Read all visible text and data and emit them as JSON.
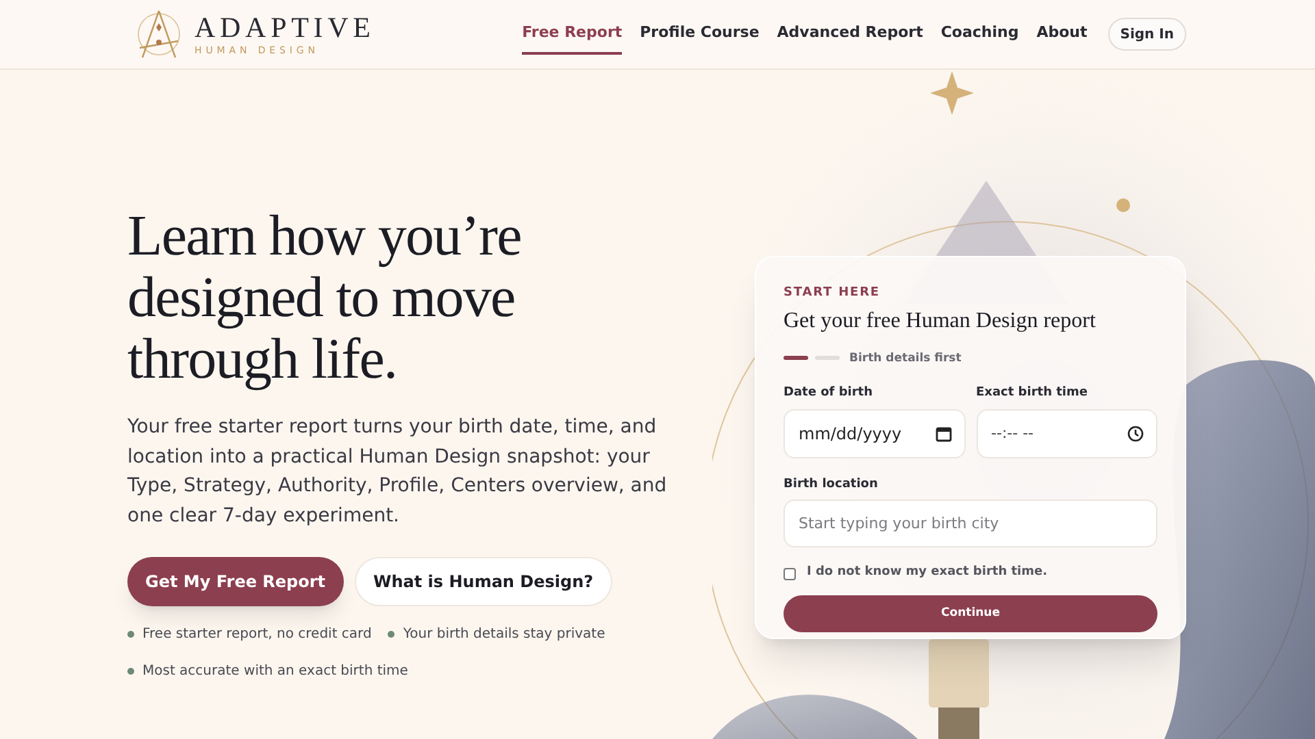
{
  "logo": {
    "name": "ADAPTIVE",
    "tagline": "HUMAN DESIGN"
  },
  "nav": {
    "items": [
      {
        "label": "Free Report",
        "selected": true
      },
      {
        "label": "Profile Course",
        "selected": false
      },
      {
        "label": "Advanced Report",
        "selected": false
      },
      {
        "label": "Coaching",
        "selected": false
      },
      {
        "label": "About",
        "selected": false
      }
    ],
    "sign_in": "Sign In"
  },
  "hero": {
    "title": "Learn how you’re designed to move through life.",
    "description": "Your free starter report turns your birth date, time, and location into a practical Human Design snapshot: your Type, Strategy, Authority, Profile, Centers overview, and one clear 7-day experiment.",
    "primary_button": "Get My Free Report",
    "secondary_button": "What is Human Design?",
    "benefits": [
      "Free starter report, no credit card",
      "Your birth details stay private",
      "Most accurate with an exact birth time"
    ]
  },
  "form": {
    "eyebrow": "START HERE",
    "title": "Get your free Human Design report",
    "progress": {
      "steps": [
        {
          "done": true
        },
        {
          "done": false
        }
      ],
      "label": "Birth details first"
    },
    "date": {
      "label": "Date of birth",
      "placeholder": "mm/dd/yyyy"
    },
    "time": {
      "label": "Exact birth time",
      "placeholder": "--:-- --"
    },
    "location": {
      "label": "Birth location",
      "placeholder": "Start typing your birth city"
    },
    "unknown_time": {
      "label": "I do not know my exact birth time.",
      "checked": false
    },
    "submit": "Continue"
  }
}
